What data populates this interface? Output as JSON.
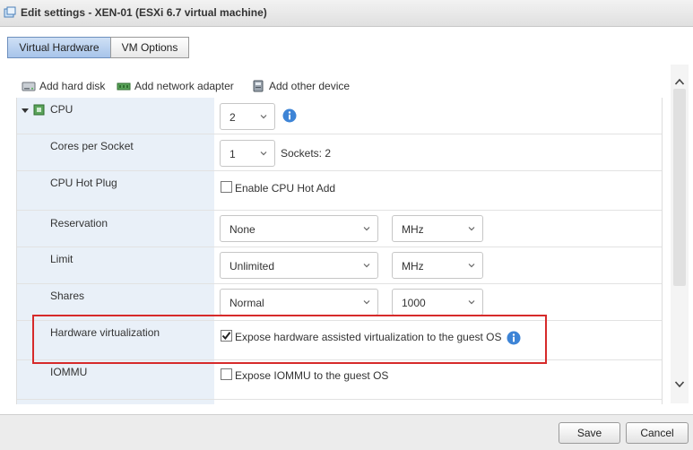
{
  "window": {
    "title": "Edit settings - XEN-01 (ESXi 6.7 virtual machine)"
  },
  "tabs": [
    {
      "label": "Virtual Hardware"
    },
    {
      "label": "VM Options"
    }
  ],
  "toolbar": {
    "add_hard_disk": "Add hard disk",
    "add_network_adapter": "Add network adapter",
    "add_other_device": "Add other device"
  },
  "rows": {
    "cpu": {
      "label": "CPU",
      "value": "2"
    },
    "cores": {
      "label": "Cores per Socket",
      "value": "1",
      "sockets": "Sockets: 2"
    },
    "hotplug": {
      "label": "CPU Hot Plug",
      "checkbox": "Enable CPU Hot Add",
      "checked": false
    },
    "reservation": {
      "label": "Reservation",
      "value": "None",
      "unit": "MHz"
    },
    "limit": {
      "label": "Limit",
      "value": "Unlimited",
      "unit": "MHz"
    },
    "shares": {
      "label": "Shares",
      "value": "Normal",
      "amount": "1000"
    },
    "hwvirt": {
      "label": "Hardware virtualization",
      "checkbox": "Expose hardware assisted virtualization to the guest OS",
      "checked": true
    },
    "iommu": {
      "label": "IOMMU",
      "checkbox": "Expose IOMMU to the guest OS",
      "checked": false
    }
  },
  "footer": {
    "save": "Save",
    "cancel": "Cancel"
  },
  "colors": {
    "highlight": "#d62a2a",
    "info": "#3d84d6",
    "label_bg": "#e9f0f8"
  }
}
